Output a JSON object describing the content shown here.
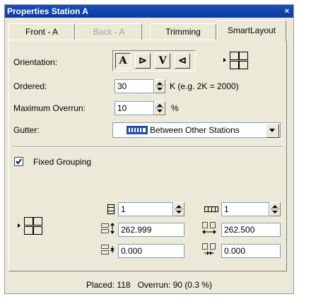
{
  "window": {
    "title": "Properties Station A",
    "close_glyph": "×"
  },
  "tabs": [
    {
      "label": "Front - A",
      "state": "normal"
    },
    {
      "label": "Back - A",
      "state": "disabled"
    },
    {
      "label": "Trimming",
      "state": "normal"
    },
    {
      "label": "SmartLayout",
      "state": "active"
    }
  ],
  "orientation": {
    "label": "Orientation:",
    "buttons": [
      {
        "glyph": "A",
        "icon": "orientation-up-icon",
        "pressed": true
      },
      {
        "glyph": "⊳",
        "icon": "orientation-right-icon",
        "pressed": false
      },
      {
        "glyph": "V",
        "icon": "orientation-down-icon",
        "pressed": false
      },
      {
        "glyph": "⊲",
        "icon": "orientation-left-icon",
        "pressed": false
      }
    ],
    "layout_icon": "grid-layout-icon"
  },
  "ordered": {
    "label": "Ordered:",
    "value": "30",
    "suffix": "K  (e.g. 2K = 2000)"
  },
  "overrun": {
    "label": "Maximum Overrun:",
    "value": "10",
    "suffix": "%"
  },
  "gutter": {
    "label": "Gutter:",
    "value": "Between Other Stations",
    "icon": "gutter-columns-icon"
  },
  "fixed_grouping": {
    "label": "Fixed Grouping",
    "checked": true
  },
  "grouping": {
    "rows": "1",
    "columns": "1",
    "height": "262.999",
    "width": "262.500",
    "vertical_gap": "0.000",
    "horizontal_gap": "0.000"
  },
  "status": {
    "placed_label": "Placed:",
    "placed": "118",
    "overrun_label": "Overrun:",
    "overrun": "90 (0.3 %)"
  }
}
